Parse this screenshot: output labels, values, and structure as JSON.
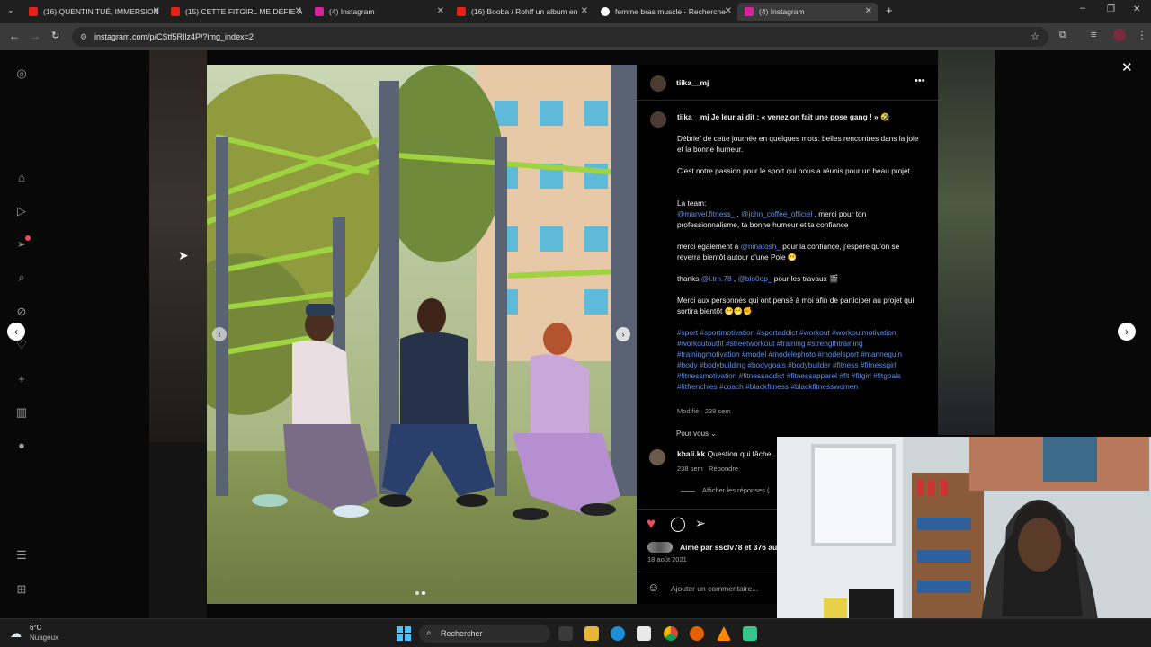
{
  "tabs": [
    {
      "label": "(16) QUENTIN TUÉ, IMMERSION",
      "favicon_color": "#e62117"
    },
    {
      "label": "(15) CETTE FITGIRL ME DÉFIE À",
      "favicon_color": "#e62117"
    },
    {
      "label": "(4) Instagram",
      "favicon_color": "#d6249f"
    },
    {
      "label": "(16) Booba / Rohff un album en",
      "favicon_color": "#e62117"
    },
    {
      "label": "femme bras muscle - Recherche",
      "favicon_color": "#ffffff"
    },
    {
      "label": "(4) Instagram",
      "favicon_color": "#d6249f"
    }
  ],
  "address": {
    "url": "instagram.com/p/CStf5RIlz4P/?img_index=2"
  },
  "post": {
    "username": "tiika__mj",
    "caption_user": "tiika__mj",
    "caption_lead": "Je leur ai dit : « venez on fait une pose gang ! »",
    "p1": "Débrief de cette journée en quelques mots: belles rencontres dans la joie et la bonne humeur.",
    "p2": "C'est notre passion pour le sport qui nous a réunis pour un beau projet.",
    "team_label": "La team:",
    "team_mention1": "@marvel.fitness_",
    "team_sep": " , ",
    "team_mention2": "@john_coffee_officiel",
    "team_rest": " , merci pour ton professionnalisme, ta bonne humeur et ta confiance",
    "merci_a": "merci également à ",
    "merci_mention": "@ninatosh_",
    "merci_rest": " pour la confiance, j'espère qu'on se reverra bientôt autour d'une Pole",
    "thanks": "thanks ",
    "thanks_m1": "@l.trn.78",
    "thanks_sep": " , ",
    "thanks_m2": "@blo0op_",
    "thanks_rest": " pour les travaux",
    "p_final": "Merci aux personnes qui ont pensé à moi afin de participer au projet qui sortira bientôt",
    "hashtags": "#sport #sportmotivation #sportaddict #workout #workoutmotivation #workoutoutfit #streetworkout #training #strengthtraining #trainingmotivation #model #modelephoto #modelsport #mannequin #body #bodybuilding #bodygoals #bodybuilder #fitness #fitnessgirl #fitnessmotivation #fitnessaddict #fitnessapparel #fit #fitgirl #fitgoals #fitfrenchies #coach #blackfitness #blackfitnesswomen",
    "modified": "Modifié · 238 sem",
    "for_you": "Pour vous",
    "comment_user": "khali.kk",
    "comment_text": "Question qui fâche",
    "comment_age": "238 sem",
    "reply_label": "Répondre",
    "view_replies": "Afficher les réponses (",
    "likes": "Aimé par ssclv78 et 376 au",
    "date": "18 août 2021",
    "add_comment": "Ajouter un commentaire..."
  },
  "taskbar": {
    "temp": "6°C",
    "weather": "Nuageux",
    "search": "Rechercher"
  },
  "colors": {
    "like": "#ed4956",
    "link": "#5f8fe6",
    "accent_green": "#a3d34a"
  }
}
